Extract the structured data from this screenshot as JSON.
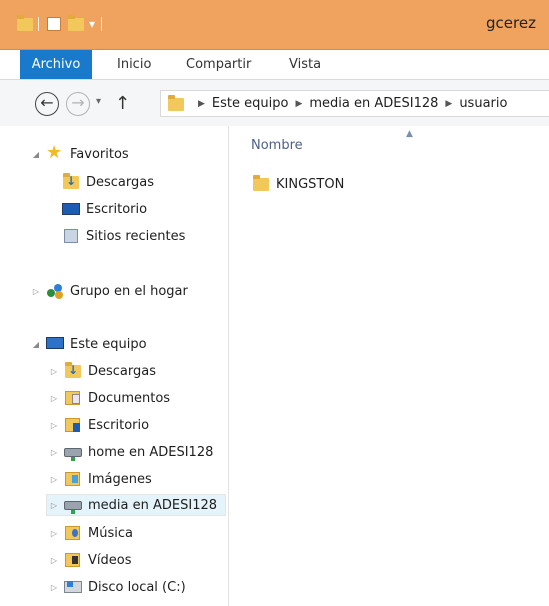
{
  "window": {
    "title": "gcerez"
  },
  "ribbon": {
    "tabs": [
      {
        "label": "Archivo"
      },
      {
        "label": "Inicio"
      },
      {
        "label": "Compartir"
      },
      {
        "label": "Vista"
      }
    ]
  },
  "nav_buttons": {
    "back": "←",
    "forward": "→",
    "recent": "▾",
    "up": "↑"
  },
  "address": {
    "crumbs": [
      "Este equipo",
      "media en ADESI128",
      "usuario"
    ]
  },
  "navpane": {
    "favorites": {
      "label": "Favoritos",
      "items": [
        "Descargas",
        "Escritorio",
        "Sitios recientes"
      ]
    },
    "homegroup": {
      "label": "Grupo en el hogar"
    },
    "this_pc": {
      "label": "Este equipo",
      "items": [
        "Descargas",
        "Documentos",
        "Escritorio",
        "home en ADESI128",
        "Imágenes",
        "media en ADESI128",
        "Música",
        "Vídeos",
        "Disco local (C:)"
      ],
      "selected": "media en ADESI128"
    }
  },
  "content": {
    "column_header": "Nombre",
    "files": [
      {
        "name": "KINGSTON",
        "icon": "folder-icon"
      }
    ]
  },
  "colors": {
    "titlebar": "#f0a35e",
    "file_tab": "#1979ca",
    "selection": "#e5f3fb"
  }
}
